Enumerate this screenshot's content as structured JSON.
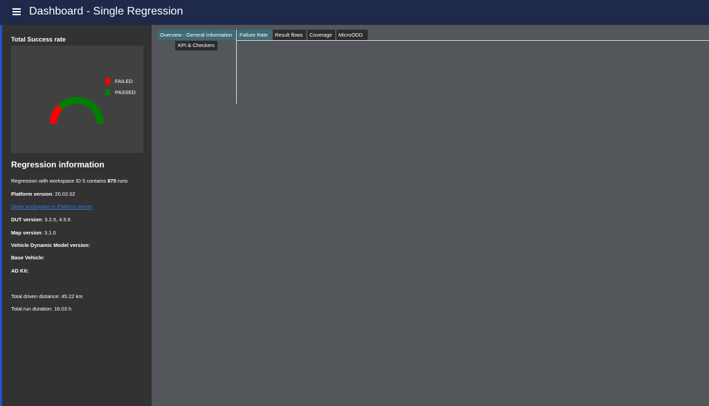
{
  "app": {
    "title": "Dashboard - Single Regression",
    "menu_icon": "hamburger-menu-icon"
  },
  "sidebar": {
    "success_rate": {
      "title": "Total Success rate",
      "legend": [
        {
          "label": "FAILED",
          "color": "#ff0000"
        },
        {
          "label": "PASSED",
          "color": "#008000"
        }
      ],
      "gauge": {
        "failed_fraction": 0.25,
        "passed_fraction": 0.75
      }
    },
    "regression": {
      "title": "Regression information",
      "summary_prefix": "Regression with workspace ID 5 contains ",
      "summary_runs": "875",
      "summary_suffix": " runs",
      "platform_label": "Platform version",
      "platform_value": ": 20.02.02",
      "workspace_link": "Open workspace in Platform server",
      "dut_label": "DUT version",
      "dut_value": ": 3.2.5, 4.5.6",
      "map_label": "Map version",
      "map_value": ": 3.1.0",
      "vehicle_model_label": "Vehicle Dynamic Model version:",
      "base_vehicle_label": "Base Vehicle:",
      "ad_kit_label": "AD Kit:",
      "distance_text": "Total driven distance: 45.22 km",
      "duration_text": "Total run duration: 16.03 h"
    }
  },
  "tabs": [
    {
      "label": "Overview - General Information",
      "active": true
    },
    {
      "label": "Failure Rate",
      "active": true
    },
    {
      "label": "Result flows",
      "active": false
    },
    {
      "label": "Coverage",
      "active": false
    },
    {
      "label": "MicroODD",
      "active": false
    }
  ],
  "subtab": {
    "label": "KPI & Checkers"
  },
  "colors": {
    "topbar": "#1f2a4a",
    "sidebar": "#323232",
    "content": "#53565b",
    "accent": "#3f6a76"
  }
}
